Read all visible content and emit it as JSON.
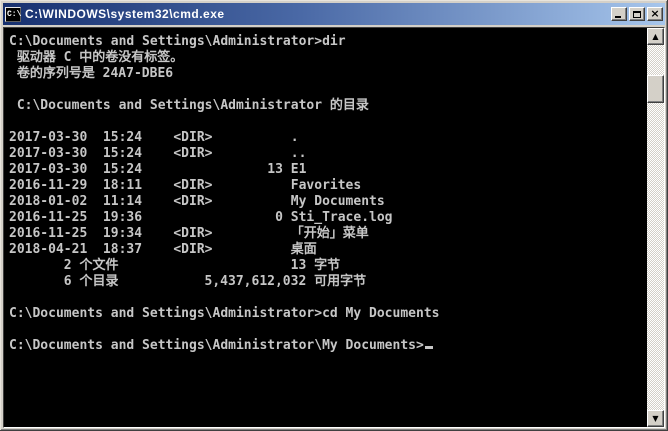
{
  "window": {
    "title": "C:\\WINDOWS\\system32\\cmd.exe",
    "icon_label": "C:\\",
    "controls": {
      "minimize": "minimize",
      "maximize": "maximize",
      "close_glyph": "×"
    }
  },
  "colors": {
    "titlebar_gradient_left": "#17306F",
    "titlebar_gradient_right": "#A7C6EC",
    "frame": "#D4D0C8",
    "console_background": "#000000",
    "console_text": "#C6C6C6"
  },
  "terminal": {
    "lines": [
      "C:\\Documents and Settings\\Administrator>dir",
      " 驱动器 C 中的卷没有标签。",
      " 卷的序列号是 24A7-DBE6",
      "",
      " C:\\Documents and Settings\\Administrator 的目录",
      "",
      "2017-03-30  15:24    <DIR>          .",
      "2017-03-30  15:24    <DIR>          ..",
      "2017-03-30  15:24                13 E1",
      "2016-11-29  18:11    <DIR>          Favorites",
      "2018-01-02  11:14    <DIR>          My Documents",
      "2016-11-25  19:36                 0 Sti_Trace.log",
      "2016-11-25  19:34    <DIR>          「开始」菜单",
      "2018-04-21  18:37    <DIR>          桌面",
      "       2 个文件                      13 字节",
      "       6 个目录           5,437,612,032 可用字节",
      "",
      "C:\\Documents and Settings\\Administrator>cd My Documents",
      "",
      "C:\\Documents and Settings\\Administrator\\My Documents>"
    ],
    "cursor": "_"
  },
  "scrollbar": {
    "up_arrow": "▲",
    "down_arrow": "▼"
  }
}
